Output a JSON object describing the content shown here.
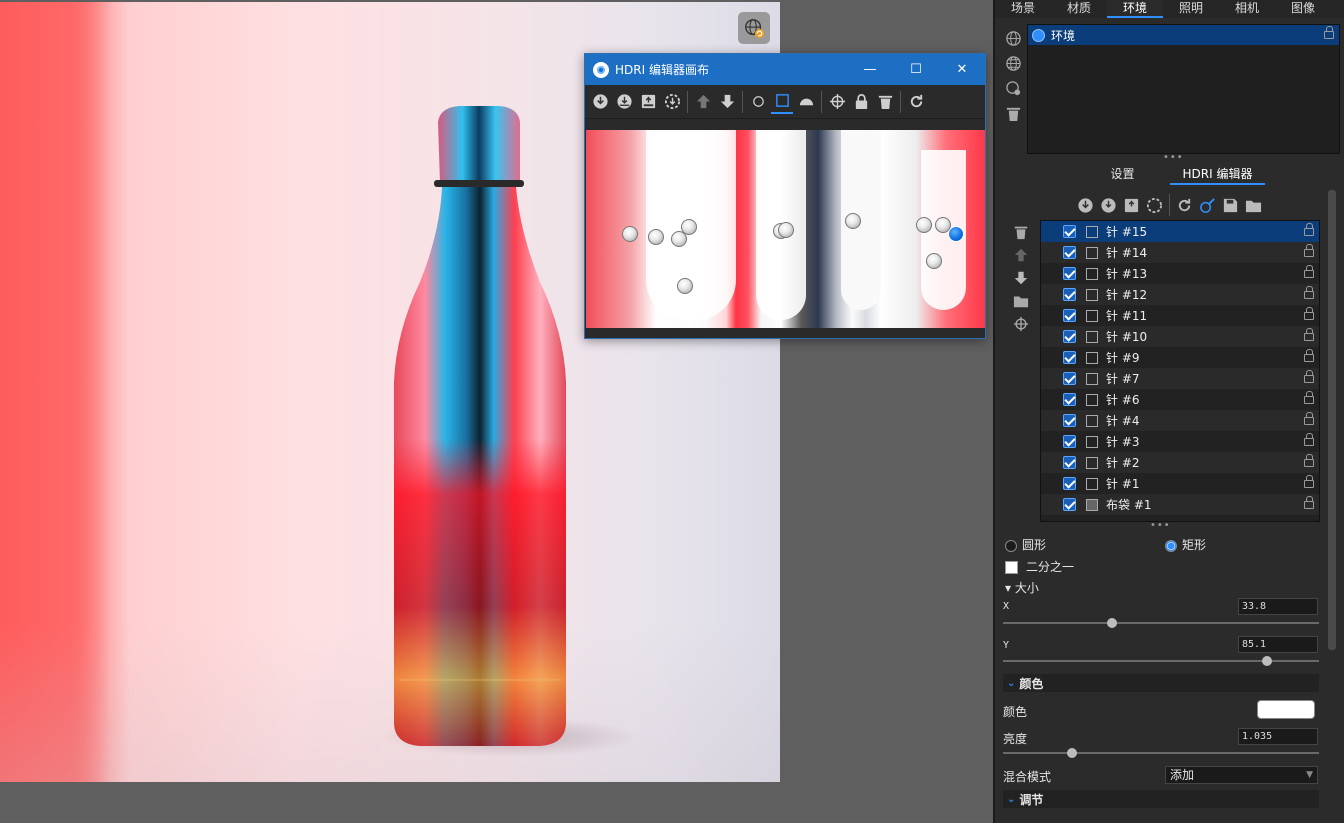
{
  "viewport": {
    "env_button_icon": "globe-refresh-icon"
  },
  "hdri_window": {
    "title": "HDRI 编辑器画布",
    "controls": {
      "minimize": "—",
      "maximize": "☐",
      "close": "✕"
    }
  },
  "panel": {
    "tabs": [
      "场景",
      "材质",
      "环境",
      "照明",
      "相机",
      "图像"
    ],
    "active_tab": "环境",
    "environment_item": "环境",
    "sub_tabs": [
      "设置",
      "HDRI 编辑器"
    ],
    "active_sub_tab": "HDRI 编辑器",
    "pins": [
      {
        "label": "针 #15",
        "selected": true
      },
      {
        "label": "针 #14"
      },
      {
        "label": "针 #13"
      },
      {
        "label": "针 #12"
      },
      {
        "label": "针 #11"
      },
      {
        "label": "针 #10"
      },
      {
        "label": "针 #9"
      },
      {
        "label": "针 #7"
      },
      {
        "label": "针 #6"
      },
      {
        "label": "针 #4"
      },
      {
        "label": "针 #3"
      },
      {
        "label": "针 #2"
      },
      {
        "label": "针 #1"
      },
      {
        "label": "布袋 #1"
      }
    ],
    "shape": {
      "circle_label": "圆形",
      "rect_label": "矩形",
      "selected": "矩形"
    },
    "half_label": "二分之一",
    "size_header": "▾ 大小",
    "x_label": "X",
    "x_value": "33.8",
    "y_label": "Y",
    "y_value": "85.1",
    "color_section": "颜色",
    "color_label": "颜色",
    "color_value": "#ffffff",
    "brightness_label": "亮度",
    "brightness_value": "1.035",
    "blend_label": "混合模式",
    "blend_value": "添加",
    "adjust_section": "调节"
  },
  "colors": {
    "accent": "#2f8fff",
    "title_bar": "#1d6fc4",
    "selection": "#0b3d7a"
  }
}
